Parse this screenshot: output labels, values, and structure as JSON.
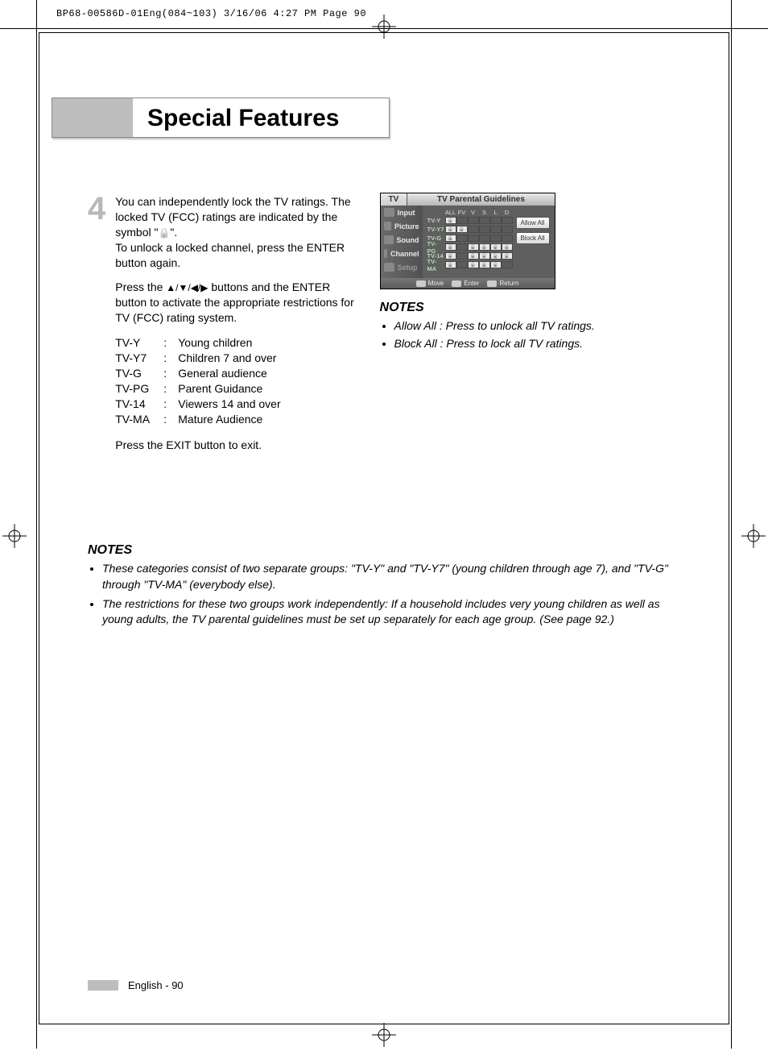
{
  "print_header": "BP68-00586D-01Eng(084~103)  3/16/06  4:27 PM  Page 90",
  "section_title": "Special Features",
  "step_number": "4",
  "step_p1a": "You can independently lock the TV ratings. The locked TV (FCC) ratings are indicated by the symbol \"",
  "step_p1b": "\".",
  "step_p2": "To unlock a locked channel, press the ENTER button again.",
  "step_p3a": "Press the ",
  "step_p3b": " buttons and the ENTER button to activate the appropriate restrictions for TV (FCC) rating system.",
  "arrows": "▲/▼/◀/▶",
  "ratings": [
    {
      "code": "TV-Y",
      "desc": "Young children"
    },
    {
      "code": "TV-Y7",
      "desc": "Children 7 and over"
    },
    {
      "code": "TV-G",
      "desc": "General audience"
    },
    {
      "code": "TV-PG",
      "desc": "Parent Guidance"
    },
    {
      "code": "TV-14",
      "desc": "Viewers 14 and over"
    },
    {
      "code": "TV-MA",
      "desc": "Mature Audience"
    }
  ],
  "step_exit": "Press the EXIT button to exit.",
  "osd": {
    "tv_tab": "TV",
    "title": "TV Parental Guidelines",
    "sidebar": [
      "Input",
      "Picture",
      "Sound",
      "Channel",
      "Setup"
    ],
    "grid_headers": [
      "ALL",
      "FV",
      "V",
      "S",
      "L",
      "D"
    ],
    "grid_rows": [
      "TV-Y",
      "TV-Y7",
      "TV-G",
      "TV-PG",
      "TV-14",
      "TV-MA"
    ],
    "buttons": {
      "allow": "Allow All",
      "block": "Block All"
    },
    "footer": {
      "move": "Move",
      "enter": "Enter",
      "return": "Return"
    }
  },
  "notes_label": "NOTES",
  "side_notes": [
    {
      "key": "Allow All :",
      "txt": "Press to unlock all TV ratings."
    },
    {
      "key": "Block All :",
      "txt": "Press to lock all TV ratings."
    }
  ],
  "lower_notes": [
    "These categories consist of two separate groups: \"TV-Y\" and \"TV-Y7\" (young children through age 7), and \"TV-G\" through \"TV-MA\" (everybody else).",
    "The restrictions for these two groups work independently: If a household includes very young children as well as young adults, the TV parental guidelines must be set up separately for each age group. (See page 92.)"
  ],
  "footer_text": "English - 90"
}
